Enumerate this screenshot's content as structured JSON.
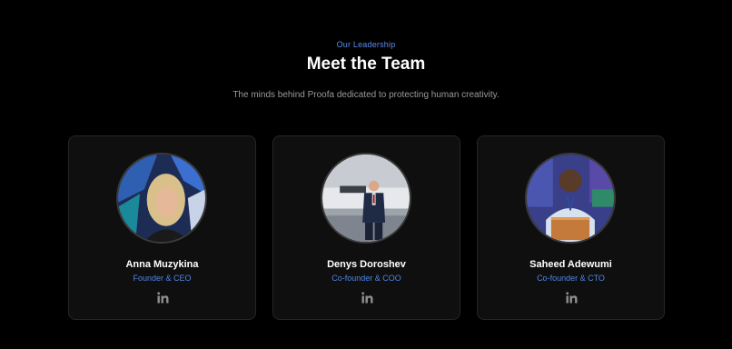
{
  "header": {
    "eyebrow": "Our Leadership",
    "title": "Meet the Team",
    "subtitle": "The minds behind Proofa dedicated to protecting human creativity."
  },
  "team": [
    {
      "name": "Anna Muzykina",
      "role": "Founder & CEO",
      "icon": "linkedin-icon"
    },
    {
      "name": "Denys Doroshev",
      "role": "Co-founder & COO",
      "icon": "linkedin-icon"
    },
    {
      "name": "Saheed Adewumi",
      "role": "Co-founder & CTO",
      "icon": "linkedin-icon"
    }
  ],
  "colors": {
    "background": "#000000",
    "card": "#0f0f0f",
    "accent": "#4f86e8",
    "title": "#ffffff",
    "muted": "#9a9a9a"
  }
}
